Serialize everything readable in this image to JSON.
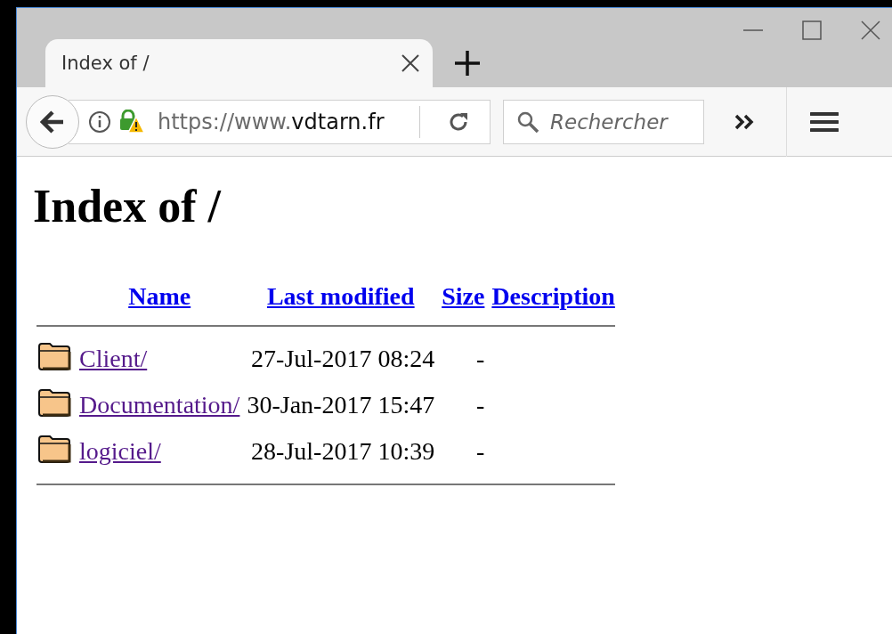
{
  "tab": {
    "title": "Index of /",
    "selected": true
  },
  "address_bar": {
    "url_prefix": "https://www.",
    "url_domain": "vdtarn.fr"
  },
  "search": {
    "placeholder": "Rechercher"
  },
  "page": {
    "heading": "Index of /",
    "columns": [
      "Name",
      "Last modified",
      "Size",
      "Description"
    ],
    "rows": [
      {
        "name": "Client/",
        "last_modified": "27-Jul-2017 08:24",
        "size": "-"
      },
      {
        "name": "Documentation/",
        "last_modified": "30-Jan-2017 15:47",
        "size": "-"
      },
      {
        "name": "logiciel/",
        "last_modified": "28-Jul-2017 10:39",
        "size": "-"
      }
    ]
  }
}
